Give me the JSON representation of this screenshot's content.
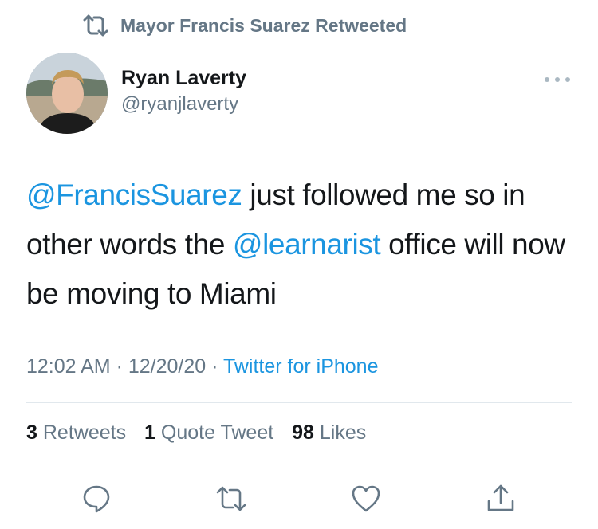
{
  "retweet_context": {
    "icon": "retweet-icon",
    "text": "Mayor Francis Suarez Retweeted"
  },
  "author": {
    "name": "Ryan Laverty",
    "handle": "@ryanjlaverty"
  },
  "more": {
    "icon": "more-dots-icon"
  },
  "tweet": {
    "mention1": "@FrancisSuarez",
    "text1": " just followed me so in other words the ",
    "mention2": "@learnarist",
    "text2": " office will now be moving to Miami"
  },
  "meta": {
    "time": "12:02 AM",
    "separator1": " · ",
    "date": "12/20/20",
    "separator2": " · ",
    "source": "Twitter for iPhone"
  },
  "stats": {
    "retweets_count": "3",
    "retweets_label": "Retweets",
    "quotes_count": "1",
    "quotes_label": "Quote Tweet",
    "likes_count": "98",
    "likes_label": "Likes"
  },
  "actions": [
    "reply-icon",
    "retweet-icon",
    "like-icon",
    "share-icon"
  ],
  "colors": {
    "link": "#1b95e0",
    "secondary": "#657786",
    "divider": "#e1e8ed",
    "text": "#14171a"
  }
}
